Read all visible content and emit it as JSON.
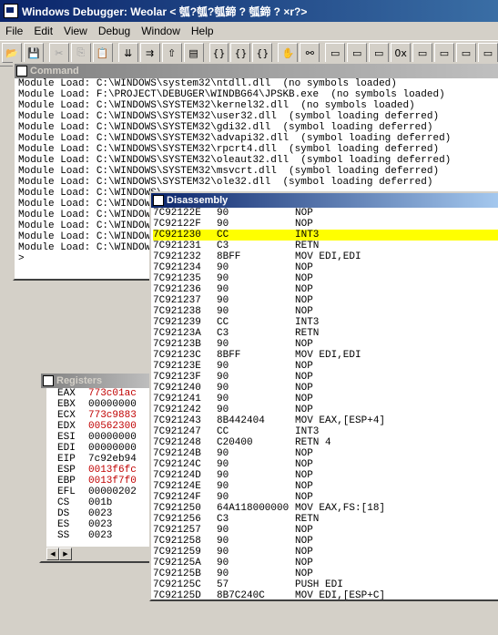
{
  "window": {
    "title": "Windows Debugger: Weolar  <      瓠?瓠?瓠鍗         ?           瓠鍗          ?          ×r?>"
  },
  "menu": [
    "File",
    "Edit",
    "View",
    "Debug",
    "Window",
    "Help"
  ],
  "toolbar": [
    {
      "icon": "open-icon",
      "glyph": "📂"
    },
    {
      "icon": "save-icon",
      "glyph": "💾"
    },
    {
      "icon": "cut-icon",
      "glyph": "✂",
      "disabled": true
    },
    {
      "icon": "copy-icon",
      "glyph": "⎘",
      "disabled": true
    },
    {
      "icon": "paste-icon",
      "glyph": "📋",
      "disabled": true
    },
    {
      "icon": "step-into-icon",
      "glyph": "⇊"
    },
    {
      "icon": "step-over-icon",
      "glyph": "⇉"
    },
    {
      "icon": "step-out-icon",
      "glyph": "⇧"
    },
    {
      "icon": "run-to-cursor-icon",
      "glyph": "▤"
    },
    {
      "icon": "brace-open-icon",
      "glyph": "{}"
    },
    {
      "icon": "brace-step-icon",
      "glyph": "{}"
    },
    {
      "icon": "brace-close-icon",
      "glyph": "{}"
    },
    {
      "icon": "hand-icon",
      "glyph": "✋"
    },
    {
      "icon": "binoculars-icon",
      "glyph": "⚯"
    },
    {
      "icon": "command-window-icon",
      "glyph": "▭"
    },
    {
      "icon": "watch-window-icon",
      "glyph": "▭"
    },
    {
      "icon": "locals-window-icon",
      "glyph": "▭"
    },
    {
      "icon": "registers-window-icon",
      "glyph": "0x"
    },
    {
      "icon": "memory-window-icon",
      "glyph": "▭"
    },
    {
      "icon": "callstack-window-icon",
      "glyph": "▭"
    },
    {
      "icon": "disassembly-window-icon",
      "glyph": "▭"
    },
    {
      "icon": "scratch-window-icon",
      "glyph": "▭"
    }
  ],
  "command": {
    "title": "Command",
    "lines": [
      "Module Load: C:\\WINDOWS\\system32\\ntdll.dll  (no symbols loaded)",
      "Module Load: F:\\PROJECT\\DEBUGER\\WINDBG64\\JPSKB.exe  (no symbols loaded)",
      "Module Load: C:\\WINDOWS\\SYSTEM32\\kernel32.dll  (no symbols loaded)",
      "Module Load: C:\\WINDOWS\\SYSTEM32\\user32.dll  (symbol loading deferred)",
      "Module Load: C:\\WINDOWS\\SYSTEM32\\gdi32.dll  (symbol loading deferred)",
      "Module Load: C:\\WINDOWS\\SYSTEM32\\advapi32.dll  (symbol loading deferred)",
      "Module Load: C:\\WINDOWS\\SYSTEM32\\rpcrt4.dll  (symbol loading deferred)",
      "Module Load: C:\\WINDOWS\\SYSTEM32\\oleaut32.dll  (symbol loading deferred)",
      "Module Load: C:\\WINDOWS\\SYSTEM32\\msvcrt.dll  (symbol loading deferred)",
      "Module Load: C:\\WINDOWS\\SYSTEM32\\ole32.dll  (symbol loading deferred)",
      "Module Load: C:\\WINDOWS\\",
      "Module Load: C:\\WINDOWS\\",
      "Module Load: C:\\WINDOWS\\",
      "Module Load: C:\\WINDOWS\\",
      "Module Load: C:\\WINDOWS\\",
      "Module Load: C:\\WINDOWS\\",
      ">"
    ]
  },
  "registers": {
    "title": "Registers",
    "rows": [
      {
        "name": "EAX",
        "value": "773c01ac",
        "changed": true
      },
      {
        "name": "EBX",
        "value": "00000000",
        "changed": false
      },
      {
        "name": "ECX",
        "value": "773c9883",
        "changed": true
      },
      {
        "name": "EDX",
        "value": "00562300",
        "changed": true
      },
      {
        "name": "ESI",
        "value": "00000000",
        "changed": false
      },
      {
        "name": "EDI",
        "value": "00000000",
        "changed": false
      },
      {
        "name": "EIP",
        "value": "7c92eb94",
        "changed": false
      },
      {
        "name": "ESP",
        "value": "0013f6fc",
        "changed": true
      },
      {
        "name": "EBP",
        "value": "0013f7f0",
        "changed": true
      },
      {
        "name": "EFL",
        "value": "00000202",
        "changed": false
      },
      {
        "name": "CS",
        "value": "001b",
        "changed": false
      },
      {
        "name": "DS",
        "value": "0023",
        "changed": false
      },
      {
        "name": "ES",
        "value": "0023",
        "changed": false
      },
      {
        "name": "SS",
        "value": "0023",
        "changed": false
      }
    ]
  },
  "disassembly": {
    "title": "Disassembly",
    "current_index": 2,
    "rows": [
      {
        "addr": "7C92122E",
        "bytes": "90",
        "instr": "NOP"
      },
      {
        "addr": "7C92122F",
        "bytes": "90",
        "instr": "NOP"
      },
      {
        "addr": "7C921230",
        "bytes": "CC",
        "instr": "INT3"
      },
      {
        "addr": "7C921231",
        "bytes": "C3",
        "instr": "RETN"
      },
      {
        "addr": "7C921232",
        "bytes": "8BFF",
        "instr": "MOV EDI,EDI"
      },
      {
        "addr": "7C921234",
        "bytes": "90",
        "instr": "NOP"
      },
      {
        "addr": "7C921235",
        "bytes": "90",
        "instr": "NOP"
      },
      {
        "addr": "7C921236",
        "bytes": "90",
        "instr": "NOP"
      },
      {
        "addr": "7C921237",
        "bytes": "90",
        "instr": "NOP"
      },
      {
        "addr": "7C921238",
        "bytes": "90",
        "instr": "NOP"
      },
      {
        "addr": "7C921239",
        "bytes": "CC",
        "instr": "INT3"
      },
      {
        "addr": "7C92123A",
        "bytes": "C3",
        "instr": "RETN"
      },
      {
        "addr": "7C92123B",
        "bytes": "90",
        "instr": "NOP"
      },
      {
        "addr": "7C92123C",
        "bytes": "8BFF",
        "instr": "MOV EDI,EDI"
      },
      {
        "addr": "7C92123E",
        "bytes": "90",
        "instr": "NOP"
      },
      {
        "addr": "7C92123F",
        "bytes": "90",
        "instr": "NOP"
      },
      {
        "addr": "7C921240",
        "bytes": "90",
        "instr": "NOP"
      },
      {
        "addr": "7C921241",
        "bytes": "90",
        "instr": "NOP"
      },
      {
        "addr": "7C921242",
        "bytes": "90",
        "instr": "NOP"
      },
      {
        "addr": "7C921243",
        "bytes": "8B442404",
        "instr": "MOV EAX,[ESP+4]"
      },
      {
        "addr": "7C921247",
        "bytes": "CC",
        "instr": "INT3"
      },
      {
        "addr": "7C921248",
        "bytes": "C20400",
        "instr": "RETN 4"
      },
      {
        "addr": "7C92124B",
        "bytes": "90",
        "instr": "NOP"
      },
      {
        "addr": "7C92124C",
        "bytes": "90",
        "instr": "NOP"
      },
      {
        "addr": "7C92124D",
        "bytes": "90",
        "instr": "NOP"
      },
      {
        "addr": "7C92124E",
        "bytes": "90",
        "instr": "NOP"
      },
      {
        "addr": "7C92124F",
        "bytes": "90",
        "instr": "NOP"
      },
      {
        "addr": "7C921250",
        "bytes": "64A118000000",
        "instr": "MOV EAX,FS:[18]"
      },
      {
        "addr": "7C921256",
        "bytes": "C3",
        "instr": "RETN"
      },
      {
        "addr": "7C921257",
        "bytes": "90",
        "instr": "NOP"
      },
      {
        "addr": "7C921258",
        "bytes": "90",
        "instr": "NOP"
      },
      {
        "addr": "7C921259",
        "bytes": "90",
        "instr": "NOP"
      },
      {
        "addr": "7C92125A",
        "bytes": "90",
        "instr": "NOP"
      },
      {
        "addr": "7C92125B",
        "bytes": "90",
        "instr": "NOP"
      },
      {
        "addr": "7C92125C",
        "bytes": "57",
        "instr": "PUSH EDI"
      },
      {
        "addr": "7C92125D",
        "bytes": "8B7C240C",
        "instr": "MOV EDI,[ESP+C]"
      }
    ]
  }
}
